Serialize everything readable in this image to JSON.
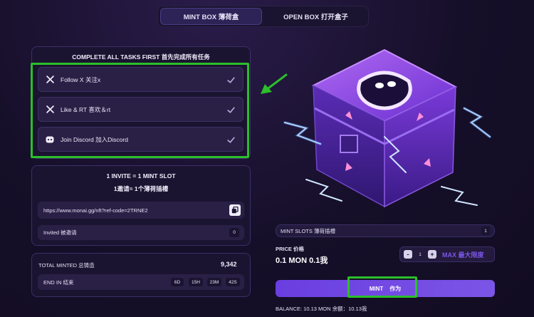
{
  "tabs": {
    "mint": "MINT BOX  薄荷盒",
    "open": "OPEN BOX  打开盒子"
  },
  "tasks": {
    "title": "COMPLETE ALL TASKS FIRST  首先完成所有任务",
    "items": [
      {
        "label": "Follow X  关注x",
        "icon": "x-icon"
      },
      {
        "label": "Like & RT  喜欢＆rt",
        "icon": "x-icon"
      },
      {
        "label": "Join Discord  加入Discord",
        "icon": "discord-icon"
      }
    ]
  },
  "invite": {
    "title_en": "1 INVITE = 1 MINT SLOT",
    "title_cn": "1邀请= 1个薄荷插槽",
    "link": "https://www.monai.gg/nft?ref-code=2TRNE2",
    "invited_label": "Invited  被邀请",
    "invited_count": "0"
  },
  "stats": {
    "total_label": "TOTAL MINTED  总铸造",
    "total_value": "9,342",
    "end_label": "END IN  结束",
    "days": "6D",
    "hours": "15H",
    "minutes": "23M",
    "seconds": "42S"
  },
  "mint": {
    "slots_label": "MINT SLOTS  薄荷插槽",
    "slots_value": "1",
    "price_label": "PRICE  价格",
    "price_value": "0.1 MON  0.1我",
    "qty_minus": "-",
    "qty": "1",
    "qty_plus": "+",
    "max_label": "MAX  最大限度",
    "button_label": "MINT    作为",
    "balance": "BALANCE: 10.13 MON  余额：10.13我"
  },
  "colors": {
    "accent": "#7b55e6",
    "highlight": "#2bbf2a",
    "panel": "#1b1431"
  }
}
